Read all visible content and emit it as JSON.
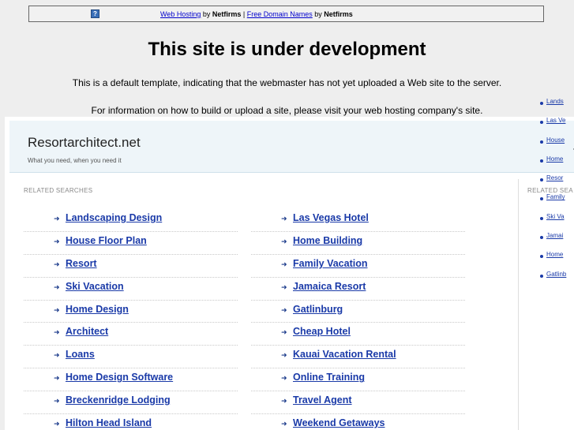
{
  "topbar": {
    "icon": "question-mark-icon",
    "link1": "Web Hosting",
    "by1": " by ",
    "brand1": "Netfirms",
    "sep": " | ",
    "link2": "Free Domain Names",
    "by2": " by ",
    "brand2": "Netfirms"
  },
  "title": "This site is under development",
  "line1": "This is a default template, indicating that the webmaster has not yet uploaded a Web site to the server.",
  "line2": "For information on how to build or upload a site, please visit your web hosting company's site.",
  "parked": {
    "site_name": "Resortarchitect.net",
    "tagline": "What you need, when you need it",
    "header_fragment": "J",
    "related_label": "RELATED SEARCHES",
    "left_links": [
      "Landscaping Design",
      "House Floor Plan",
      "Resort",
      "Ski Vacation",
      "Home Design",
      "Architect",
      "Loans",
      "Home Design Software",
      "Breckenridge Lodging",
      "Hilton Head Island"
    ],
    "right_links": [
      "Las Vegas Hotel",
      "Home Building",
      "Family Vacation",
      "Jamaica Resort",
      "Gatlinburg",
      "Cheap Hotel",
      "Kauai Vacation Rental",
      "Online Training",
      "Travel Agent",
      "Weekend Getaways"
    ],
    "side_label": "RELATED SEA",
    "side_links": [
      "Lands",
      "Las Ve",
      "House",
      "Home",
      "Resor",
      "Family",
      "Ski Va",
      "Jamai",
      "Home",
      "Gatlinb"
    ]
  }
}
